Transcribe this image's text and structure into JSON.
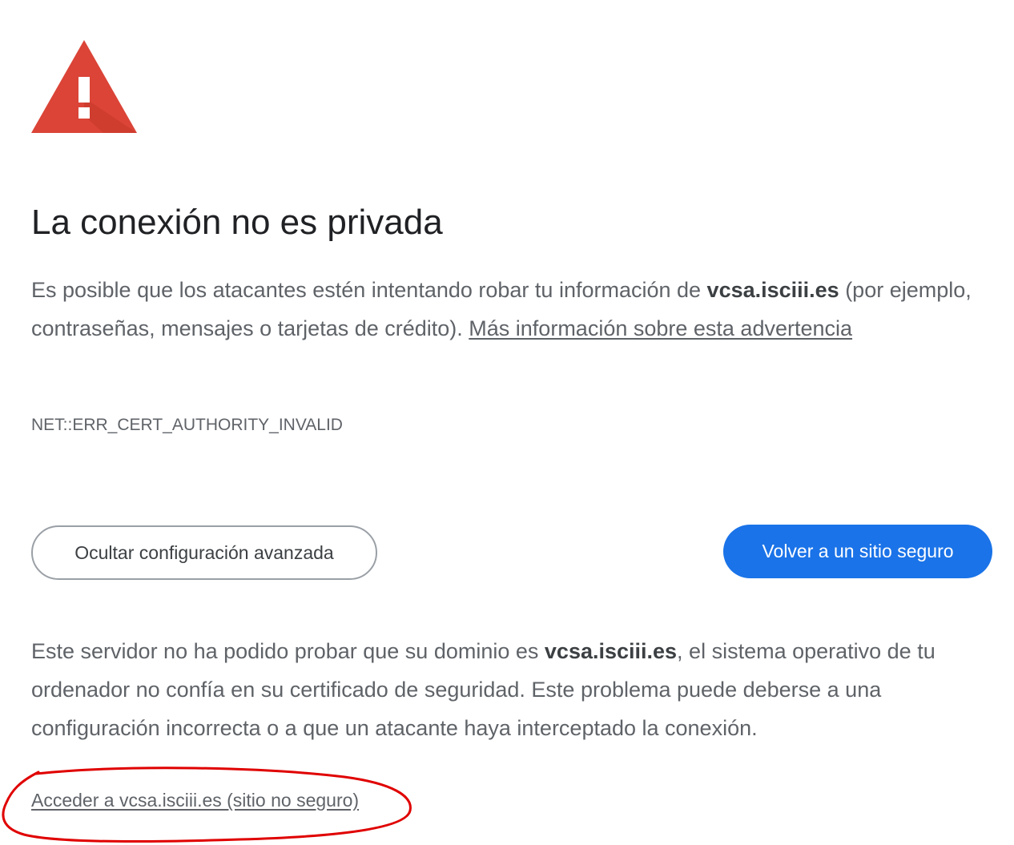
{
  "page": {
    "title": "La conexión no es privada",
    "intro": {
      "text_before": "Es posible que los atacantes estén intentando robar tu información de ",
      "domain": "vcsa.isciii.es",
      "text_after": " (por ejemplo, contraseñas, mensajes o tarjetas de crédito). ",
      "learn_more_link": "Más información sobre esta advertencia"
    },
    "error_code": "NET::ERR_CERT_AUTHORITY_INVALID",
    "buttons": {
      "advanced": "Ocultar configuración avanzada",
      "back_to_safety": "Volver a un sitio seguro"
    },
    "details": {
      "text_before": "Este servidor no ha podido probar que su dominio es ",
      "domain": "vcsa.isciii.es",
      "text_after": ", el sistema operativo de tu ordenador no confía en su certificado de seguridad. Este problema puede deberse a una configuración incorrecta o a que un atacante haya interceptado la conexión."
    },
    "proceed_link": "Acceder a vcsa.isciii.es (sitio no seguro)"
  },
  "icons": {
    "warning": "warning-triangle-icon"
  },
  "colors": {
    "warning_red": "#db4437",
    "primary_blue": "#1a73e8",
    "annotation_red": "#e00000"
  }
}
